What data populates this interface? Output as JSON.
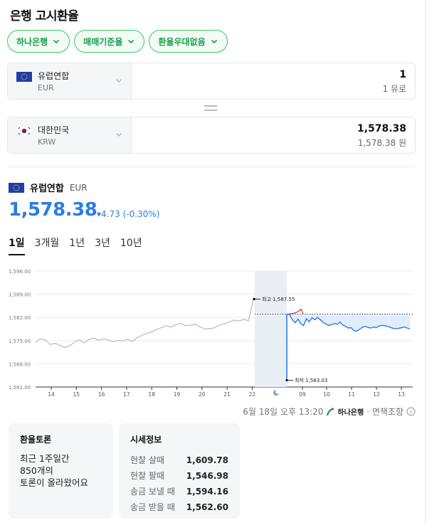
{
  "page_title": "은행 고시환율",
  "filters": [
    {
      "label": "하나은행"
    },
    {
      "label": "매매기준율"
    },
    {
      "label": "환율우대없음"
    }
  ],
  "from_currency": {
    "name": "유럽연합",
    "code": "EUR",
    "amount": "1",
    "amount_sub": "1 유로",
    "flag": "eu-flag"
  },
  "to_currency": {
    "name": "대한민국",
    "code": "KRW",
    "amount": "1,578.38",
    "amount_sub": "1,578.38 원",
    "flag": "kr-flag"
  },
  "rate_header": {
    "name": "유럽연합",
    "code": "EUR"
  },
  "rate": {
    "value": "1,578.38",
    "change": "▾4.73 (-0.30%)"
  },
  "tabs": [
    {
      "label": "1일",
      "active": true
    },
    {
      "label": "3개월"
    },
    {
      "label": "1년"
    },
    {
      "label": "3년"
    },
    {
      "label": "10년"
    }
  ],
  "chart_data": {
    "type": "line",
    "ylim": [
      1561,
      1596
    ],
    "yticks": [
      "1,596.00",
      "1,589.00",
      "1,582.00",
      "1,575.00",
      "1,568.00",
      "1,561.00"
    ],
    "xticks": [
      "14",
      "15",
      "16",
      "17",
      "18",
      "19",
      "20",
      "21",
      "22",
      "09",
      "10",
      "11",
      "12",
      "13"
    ],
    "night_icon": "moon-icon",
    "max_label": "최고 1,587.55",
    "min_label": "최저 1,563.03",
    "max_value": 1587.55,
    "min_value": 1563.03,
    "reference": 1583.0,
    "series": [
      {
        "segment": "previous",
        "values": [
          1574.5,
          1575.6,
          1575.2,
          1573.8,
          1574.2,
          1573.6,
          1572.9,
          1573.4,
          1574.5,
          1575.2,
          1574.3,
          1575.3,
          1575.8,
          1575.1,
          1575.5,
          1575.2,
          1574.6,
          1575.1,
          1574.9,
          1575.4,
          1574.7,
          1575.9,
          1576.6,
          1577.2,
          1577.6,
          1578.4,
          1578.9,
          1579.5,
          1579.1,
          1579.8,
          1580.2,
          1579.5,
          1579.7,
          1579.9,
          1579.1,
          1578.5,
          1578.6,
          1578.9,
          1579.7,
          1580.1,
          1580.6,
          1581.2,
          1580.9,
          1581.4,
          1581.0,
          1587.5
        ]
      },
      {
        "segment": "current",
        "values": [
          1583.0,
          1582.8,
          1581.3,
          1580.4,
          1581.5,
          1580.1,
          1579.5,
          1581.6,
          1580.7,
          1581.9,
          1581.3,
          1582.0,
          1581.3,
          1580.5,
          1580.0,
          1579.6,
          1579.8,
          1580.2,
          1579.9,
          1580.6,
          1579.7,
          1579.3,
          1578.8,
          1578.9,
          1578.0,
          1577.9,
          1578.4,
          1579.0,
          1579.3,
          1579.0,
          1578.8,
          1579.1,
          1578.9,
          1579.4,
          1579.6,
          1579.5,
          1579.3,
          1579.0,
          1578.7,
          1578.6,
          1578.7,
          1578.9,
          1579.1,
          1578.8,
          1578.5
        ]
      }
    ]
  },
  "footer": {
    "timestamp": "6월 18일 오후 13:20",
    "bank": "하나은행",
    "disclaimer": "· 면책조항"
  },
  "discussion": {
    "title": "환율토론",
    "lines": [
      "최근 1주일간",
      "850개의",
      "토론이 올라왔어요"
    ]
  },
  "market_info": {
    "title": "시세정보",
    "rows": [
      {
        "k": "현찰 살때",
        "v": "1,609.78"
      },
      {
        "k": "현찰 팔때",
        "v": "1,546.98"
      },
      {
        "k": "송금 보낼 때",
        "v": "1,594.16"
      },
      {
        "k": "송금 받을 때",
        "v": "1,562.60"
      }
    ]
  },
  "colors": {
    "accent": "#2a7de1",
    "green": "#15a04a",
    "prev_line": "#b9b5cf",
    "red": "#e23b3b"
  }
}
